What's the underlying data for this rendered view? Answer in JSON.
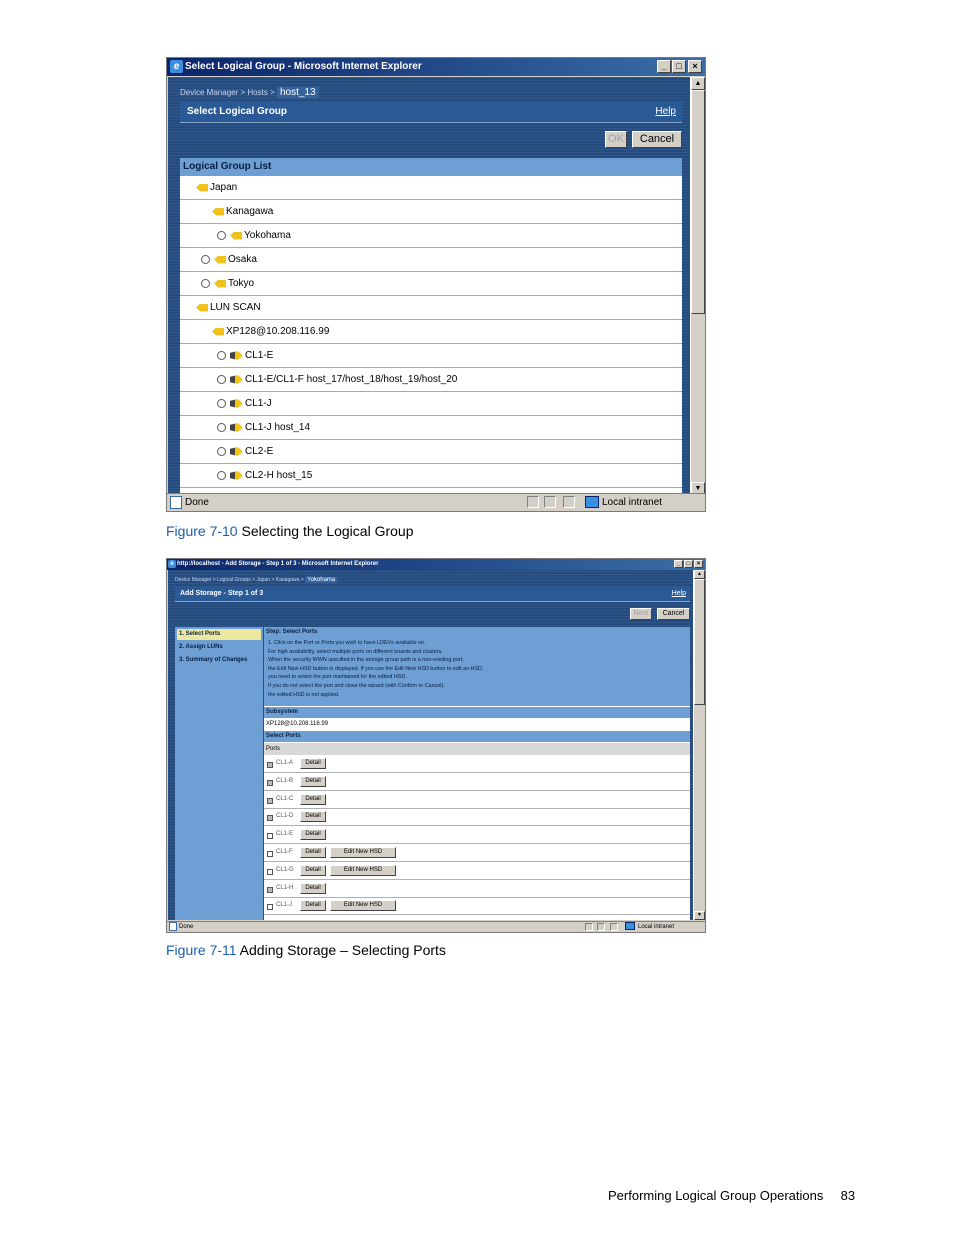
{
  "window1": {
    "title": "Select Logical Group - Microsoft Internet Explorer",
    "breadcrumb": [
      "Device Manager",
      "Hosts",
      "host_13"
    ],
    "page_title": "Select Logical Group",
    "help": "Help",
    "ok": "OK",
    "cancel": "Cancel",
    "list_header": "Logical Group List",
    "rows": [
      {
        "label": "Japan",
        "indent": 0,
        "radio": false,
        "icon": "group-icon"
      },
      {
        "label": "Kanagawa",
        "indent": 1,
        "radio": false,
        "icon": "group-icon"
      },
      {
        "label": "Yokohama",
        "indent": 2,
        "radio": true,
        "icon": "group-icon"
      },
      {
        "label": "Osaka",
        "indent": 1,
        "radio": true,
        "icon": "group-icon"
      },
      {
        "label": "Tokyo",
        "indent": 1,
        "radio": true,
        "icon": "group-icon"
      },
      {
        "label": "LUN SCAN",
        "indent": 0,
        "radio": false,
        "icon": "group-icon"
      },
      {
        "label": "XP128@10.208.116.99",
        "indent": 1,
        "radio": false,
        "icon": "group-icon"
      },
      {
        "label": "CL1-E",
        "indent": 2,
        "radio": true,
        "icon": "storage-group-icon"
      },
      {
        "label": "CL1-E/CL1-F host_17/host_18/host_19/host_20",
        "indent": 2,
        "radio": true,
        "icon": "storage-group-icon"
      },
      {
        "label": "CL1-J",
        "indent": 2,
        "radio": true,
        "icon": "storage-group-icon"
      },
      {
        "label": "CL1-J host_14",
        "indent": 2,
        "radio": true,
        "icon": "storage-group-icon"
      },
      {
        "label": "CL2-E",
        "indent": 2,
        "radio": true,
        "icon": "storage-group-icon"
      },
      {
        "label": "CL2-H host_15",
        "indent": 2,
        "radio": true,
        "icon": "storage-group-icon"
      }
    ],
    "status_left": "Done",
    "status_zone": "Local intranet"
  },
  "caption1": {
    "fig": "Figure 7-10",
    "text": " Selecting the Logical Group"
  },
  "window2": {
    "title": "http://localhost - Add Storage - Step 1 of 3 - Microsoft Internet Explorer",
    "breadcrumb": [
      "Device Manager",
      "Logical Groups",
      "Japan",
      "Kanagawa",
      "Yokohama"
    ],
    "page_title": "Add Storage - Step 1 of 3",
    "help": "Help",
    "next": "Next",
    "cancel": "Cancel",
    "steps": [
      "1. Select Ports",
      "2. Assign LUNs",
      "3. Summary of Changes"
    ],
    "step_title": "Step: Select Ports",
    "step_lines": [
      "1. Click on the Port or Ports you wish to have LDEVs available on.",
      "For high availability, select multiple ports on different boards and clusters.",
      "When the security WWN specified in the storage group path is a non-existing port,",
      "the Edit New HSD button is displayed. If you use the Edit New HSD button to edit an HSD,",
      "you need to select the port maintained for the edited HSD.",
      "If you do not select the port and close the wizard (with Confirm or Cancel),",
      "the edited HSD is not applied."
    ],
    "subsystem_label": "Subsystem",
    "subsystem_value": "XP128@10.208.116.99",
    "select_ports_label": "Select Ports",
    "ports_col": "Ports",
    "detail_label": "Detail",
    "edit_hsd_label": "Edit New HSD",
    "ports": [
      {
        "name": "CL1-A",
        "disabled": true,
        "edit": false
      },
      {
        "name": "CL1-B",
        "disabled": true,
        "edit": false
      },
      {
        "name": "CL1-C",
        "disabled": true,
        "edit": false
      },
      {
        "name": "CL1-D",
        "disabled": true,
        "edit": false
      },
      {
        "name": "CL1-E",
        "disabled": false,
        "edit": false
      },
      {
        "name": "CL1-F",
        "disabled": false,
        "edit": true
      },
      {
        "name": "CL1-G",
        "disabled": false,
        "edit": true
      },
      {
        "name": "CL1-H",
        "disabled": true,
        "edit": false
      },
      {
        "name": "CL1-J",
        "disabled": false,
        "edit": true
      }
    ],
    "status_left": "Done",
    "status_zone": "Local intranet"
  },
  "caption2": {
    "fig": "Figure 7-11",
    "text": " Adding Storage – Selecting Ports"
  },
  "footer": {
    "section": "Performing Logical Group Operations",
    "page": "83"
  }
}
